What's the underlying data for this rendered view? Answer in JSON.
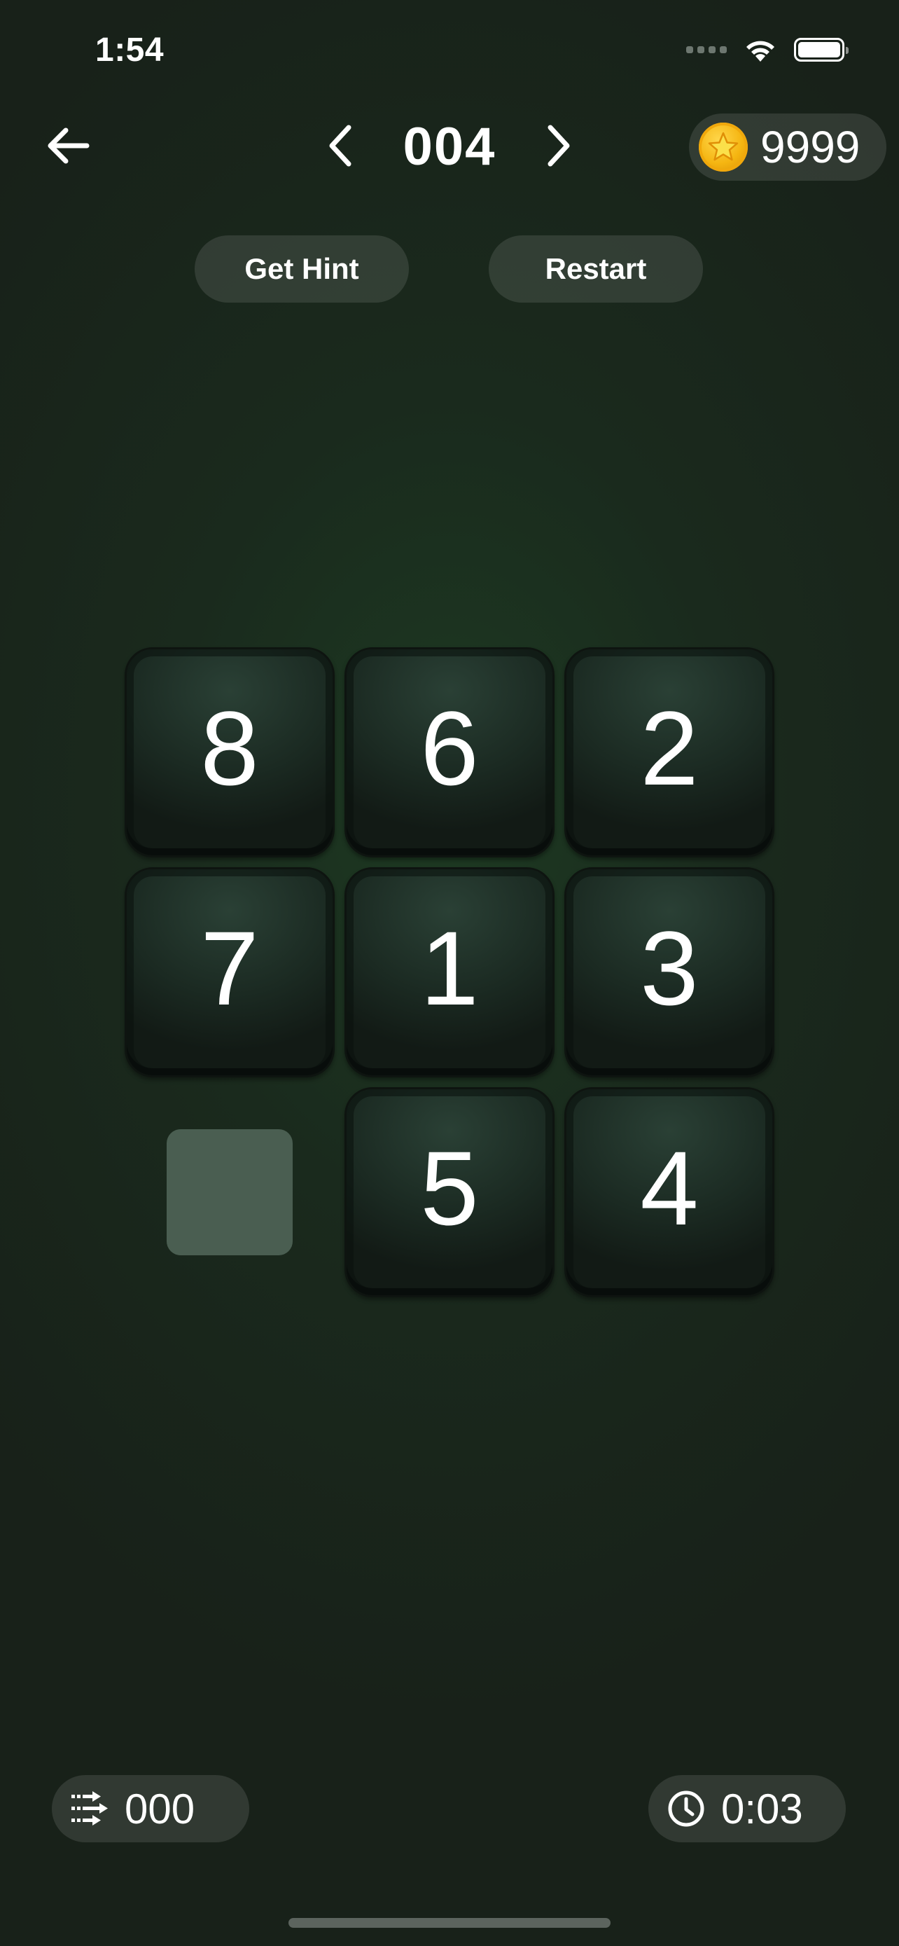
{
  "status_bar": {
    "time": "1:54",
    "icons": [
      "signal-icon",
      "wifi-icon",
      "battery-icon"
    ]
  },
  "header": {
    "back_icon": "arrow-left-icon",
    "prev_icon": "chevron-left-icon",
    "next_icon": "chevron-right-icon",
    "level": "004",
    "coin_icon": "star-coin-icon",
    "coins": "9999"
  },
  "actions": {
    "hint_label": "Get Hint",
    "restart_label": "Restart"
  },
  "board": {
    "rows": 3,
    "cols": 3,
    "tiles": [
      "8",
      "6",
      "2",
      "7",
      "1",
      "3",
      "",
      "5",
      "4"
    ],
    "empty_color": "#4a5e51"
  },
  "footer": {
    "moves_icon": "moves-arrows-icon",
    "moves": "000",
    "timer_icon": "clock-icon",
    "time": "0:03"
  },
  "colors": {
    "background": "#1a2a1d",
    "pill": "#2e3a31",
    "coin": "#f5b511"
  }
}
